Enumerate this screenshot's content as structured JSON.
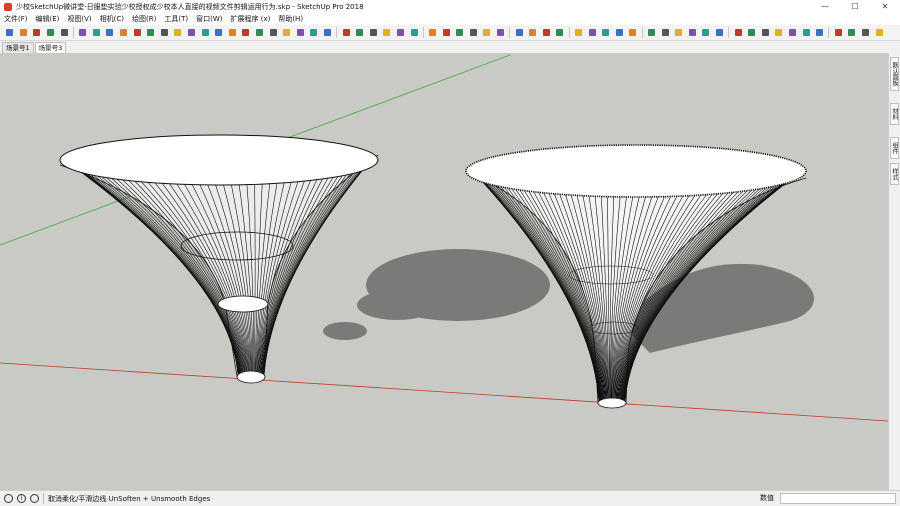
{
  "window": {
    "title": "少校SketchUp微讲堂-日服垫实验少校授权成少校本人直接的视频文件剪辑运用行为.skp - SketchUp Pro 2018",
    "minimize": "—",
    "maximize": "☐",
    "close": "✕"
  },
  "menu": [
    "文件(F)",
    "编辑(E)",
    "视图(V)",
    "相机(C)",
    "绘图(R)",
    "工具(T)",
    "窗口(W)",
    "扩展程序 (x)",
    "帮助(H)"
  ],
  "scenes": [
    {
      "label": "场景号1",
      "active": false
    },
    {
      "label": "场景号3",
      "active": true
    }
  ],
  "trays": [
    "默认面板",
    "材料",
    "组件",
    "样式"
  ],
  "status": {
    "message": "取消柔化/平滑边线 UnSoften + Unsmooth Edges",
    "measure_label": "数值",
    "measure_value": ""
  },
  "colors": {
    "viewport_bg": "#c9c9c5",
    "shadow": "#7a7a78",
    "red_axis": "#c0392b",
    "green_axis": "#3aa83a",
    "line": "#111111"
  },
  "toolbar_icons": [
    "new-icon",
    "open-icon",
    "save-icon",
    "undo-icon",
    "print-icon",
    "sep",
    "select-icon",
    "component-icon",
    "paint-icon",
    "eraser-icon",
    "paint-bucket-icon",
    "tag-icon",
    "line-icon",
    "arc-icon",
    "freehand-icon",
    "rectangle-icon",
    "rotated-rect-icon",
    "circle-icon",
    "polygon-icon",
    "pushpull-icon",
    "followme-icon",
    "offset-icon",
    "move-icon",
    "rotate-icon",
    "scale-icon",
    "sep",
    "tape-icon",
    "dimension-icon",
    "protractor-icon",
    "text-icon",
    "axes-icon",
    "3dtext-icon",
    "sep",
    "orbit-icon",
    "pan-icon",
    "zoom-icon",
    "zoom-window-icon",
    "zoom-extents-icon",
    "previous-icon",
    "sep",
    "position-camera-icon",
    "walk-icon",
    "lookaround-icon",
    "section-icon",
    "sep",
    "sandbox-icon",
    "stamp-icon",
    "drape-icon",
    "add-detail-icon",
    "flip-edge-icon",
    "sep",
    "iso-view-icon",
    "top-view-icon",
    "front-view-icon",
    "right-view-icon",
    "back-view-icon",
    "left-view-icon",
    "sep",
    "xray-icon",
    "backedges-icon",
    "wireframe-icon",
    "hidden-line-icon",
    "shaded-icon",
    "textured-icon",
    "monochrome-icon",
    "sep",
    "warehouse-icon",
    "share-icon",
    "extension-icon",
    "ruby-icon"
  ]
}
